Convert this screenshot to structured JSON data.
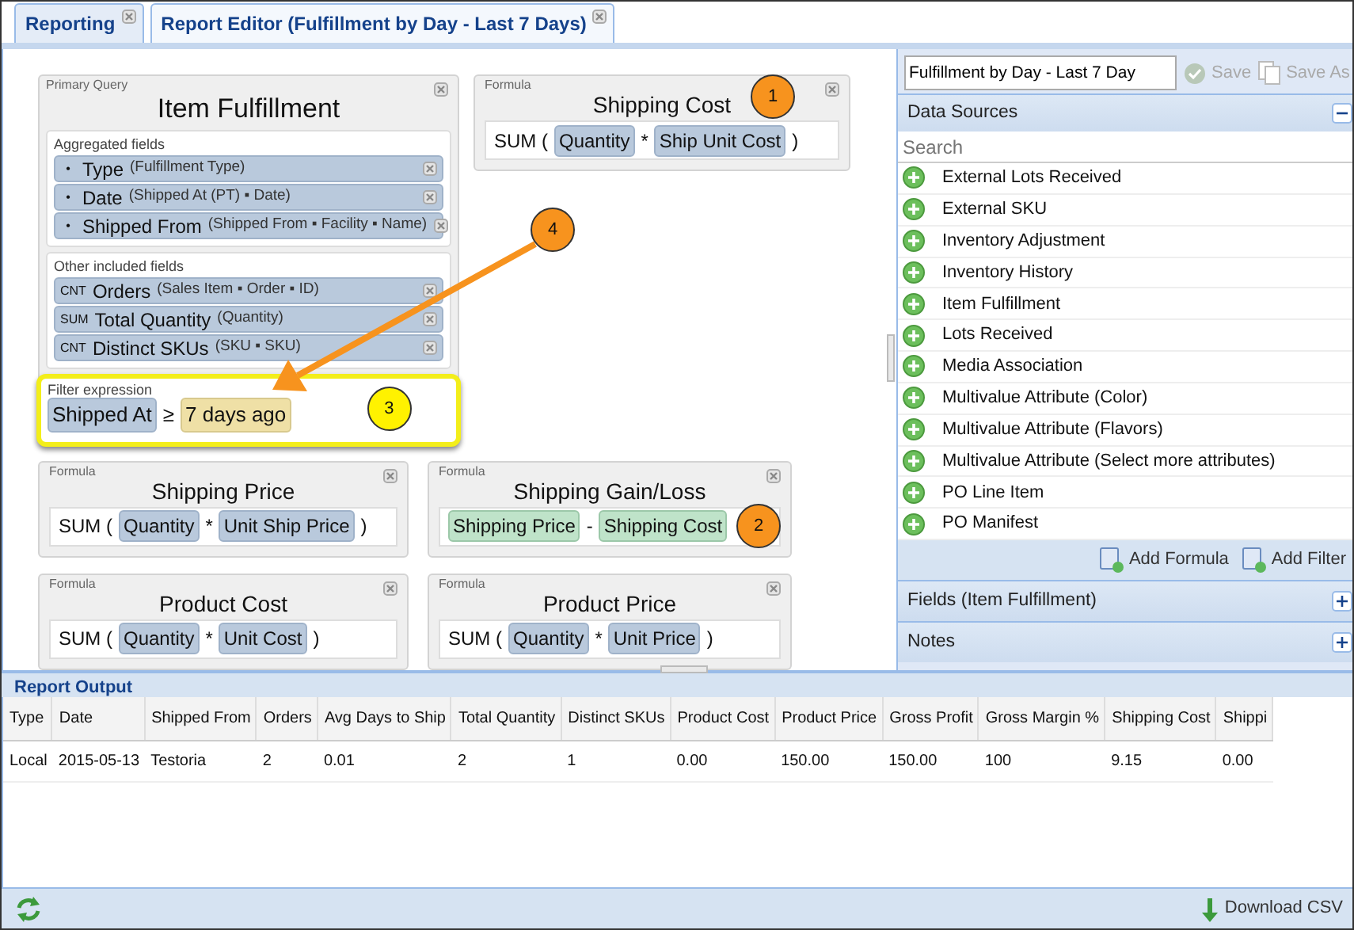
{
  "tabs": [
    {
      "label": "Reporting",
      "selected": false
    },
    {
      "label": "Report Editor (Fulfillment by Day - Last 7 Days)",
      "selected": true
    }
  ],
  "primary_query": {
    "caption": "Primary Query",
    "title": "Item Fulfillment",
    "sections": [
      {
        "caption": "Aggregated fields",
        "fields": [
          {
            "prefix": "•",
            "name": "Type",
            "detail": "(Fulfillment Type)"
          },
          {
            "prefix": "•",
            "name": "Date",
            "detail": "(Shipped At (PT) ▪ Date)"
          },
          {
            "prefix": "•",
            "name": "Shipped From",
            "detail": "(Shipped From ▪ Facility ▪ Name)"
          }
        ]
      },
      {
        "caption": "Other included fields",
        "fields": [
          {
            "prefix": "CNT",
            "name": "Orders",
            "detail": "(Sales Item ▪ Order ▪ ID)"
          },
          {
            "prefix": "SUM",
            "name": "Total Quantity",
            "detail": "(Quantity)"
          },
          {
            "prefix": "CNT",
            "name": "Distinct SKUs",
            "detail": "(SKU ▪ SKU)"
          }
        ]
      }
    ],
    "filter": {
      "caption": "Filter expression",
      "highlighted": true,
      "tokens": [
        {
          "kind": "field",
          "text": "Shipped At"
        },
        {
          "kind": "plain",
          "text": "≥"
        },
        {
          "kind": "value",
          "text": "7 days ago"
        }
      ],
      "callout": {
        "text": "3",
        "color": "#fff200"
      }
    }
  },
  "formulas": [
    {
      "caption": "Formula",
      "title": "Shipping Cost",
      "tokens": [
        {
          "kind": "plain",
          "text": "SUM ("
        },
        {
          "kind": "field",
          "text": "Quantity"
        },
        {
          "kind": "plain",
          "text": "*"
        },
        {
          "kind": "field",
          "text": "Ship Unit Cost"
        },
        {
          "kind": "plain",
          "text": ")"
        }
      ],
      "title_callout": {
        "text": "1",
        "color": "#f7931e"
      }
    },
    {
      "caption": "Formula",
      "title": "Shipping Price",
      "tokens": [
        {
          "kind": "plain",
          "text": "SUM ("
        },
        {
          "kind": "field",
          "text": "Quantity"
        },
        {
          "kind": "plain",
          "text": "*"
        },
        {
          "kind": "field",
          "text": "Unit Ship Price"
        },
        {
          "kind": "plain",
          "text": ")"
        }
      ]
    },
    {
      "caption": "Formula",
      "title": "Shipping Gain/Loss",
      "tokens": [
        {
          "kind": "formula",
          "text": "Shipping Price"
        },
        {
          "kind": "plain",
          "text": "-"
        },
        {
          "kind": "formula",
          "text": "Shipping Cost"
        }
      ],
      "expression_callout": {
        "text": "2",
        "color": "#f7931e"
      }
    },
    {
      "caption": "Formula",
      "title": "Product Cost",
      "tokens": [
        {
          "kind": "plain",
          "text": "SUM ("
        },
        {
          "kind": "field",
          "text": "Quantity"
        },
        {
          "kind": "plain",
          "text": "*"
        },
        {
          "kind": "field",
          "text": "Unit Cost"
        },
        {
          "kind": "plain",
          "text": ")"
        }
      ]
    },
    {
      "caption": "Formula",
      "title": "Product Price",
      "tokens": [
        {
          "kind": "plain",
          "text": "SUM ("
        },
        {
          "kind": "field",
          "text": "Quantity"
        },
        {
          "kind": "plain",
          "text": "*"
        },
        {
          "kind": "field",
          "text": "Unit Price"
        },
        {
          "kind": "plain",
          "text": ")"
        }
      ]
    }
  ],
  "arrow_callout": {
    "text": "4",
    "color": "#f7931e"
  },
  "side_panel": {
    "report_name": "Fulfillment by Day - Last 7 Day",
    "buttons": [
      {
        "label": "Save",
        "disabled": true
      },
      {
        "label": "Save As",
        "disabled": true
      }
    ],
    "data_sources": {
      "title": "Data Sources",
      "expanded": true,
      "search": {
        "placeholder": "Search"
      },
      "items": [
        "External Lots Received",
        "External SKU",
        "Inventory Adjustment",
        "Inventory History",
        "Item Fulfillment",
        "Lots Received",
        "Media Association",
        "Multivalue Attribute (Color)",
        "Multivalue Attribute (Flavors)",
        "Multivalue Attribute (Select more attributes)",
        "PO Line Item",
        "PO Manifest"
      ],
      "actions": [
        "Add Formula",
        "Add Filter"
      ]
    },
    "sections": [
      {
        "title": "Fields (Item Fulfillment)",
        "expanded": false
      },
      {
        "title": "Notes",
        "expanded": false
      }
    ]
  },
  "report_output": {
    "title": "Report Output",
    "columns": [
      "Type",
      "Date",
      "Shipped From",
      "Orders",
      "Avg Days to Ship",
      "Total Quantity",
      "Distinct SKUs",
      "Product Cost",
      "Product Price",
      "Gross Profit",
      "Gross Margin %",
      "Shipping Cost",
      "Shippi"
    ],
    "rows": [
      [
        "Local",
        "2015-05-13",
        "Testoria",
        "2",
        "0.01",
        "2",
        "1",
        "0.00",
        "150.00",
        "150.00",
        "100",
        "9.15",
        "0.00"
      ]
    ],
    "download": "Download CSV"
  }
}
